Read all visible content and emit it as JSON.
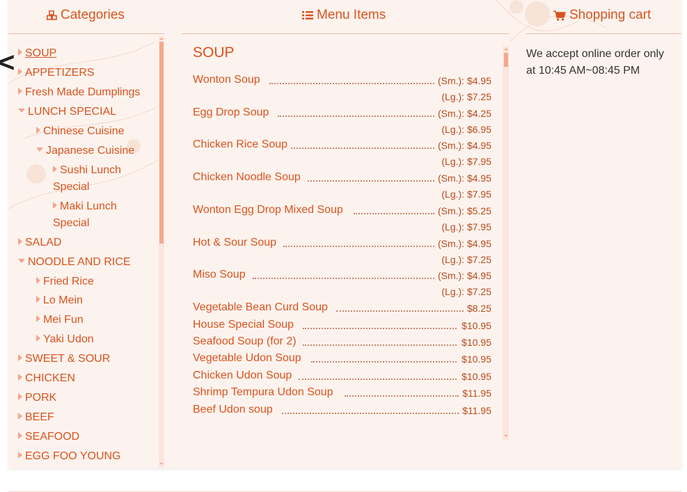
{
  "header": {
    "categories_label": "Categories",
    "menu_items_label": "Menu Items",
    "cart_label": "Shopping cart"
  },
  "sidebar": {
    "items": [
      {
        "label": "SOUP",
        "state": "active"
      },
      {
        "label": "APPETIZERS"
      },
      {
        "label": "Fresh Made Dumplings"
      },
      {
        "label": "LUNCH SPECIAL",
        "expanded": true
      },
      {
        "label": "Chinese Cuisine"
      },
      {
        "label": "Japanese Cuisine",
        "expanded": true
      },
      {
        "label": "Sushi Lunch Special"
      },
      {
        "label": "Maki Lunch Special"
      },
      {
        "label": "SALAD"
      },
      {
        "label": "NOODLE AND RICE",
        "expanded": true
      },
      {
        "label": "Fried Rice"
      },
      {
        "label": "Lo Mein"
      },
      {
        "label": "Mei Fun"
      },
      {
        "label": "Yaki Udon"
      },
      {
        "label": "SWEET & SOUR"
      },
      {
        "label": "CHICKEN"
      },
      {
        "label": "PORK"
      },
      {
        "label": "BEEF"
      },
      {
        "label": "SEAFOOD"
      },
      {
        "label": "EGG FOO YOUNG"
      }
    ]
  },
  "menu": {
    "title": "SOUP",
    "items": [
      {
        "name": "Wonton Soup",
        "price_sm": "(Sm.): $4.95",
        "price_lg": "(Lg.): $7.25"
      },
      {
        "name": "Egg Drop Soup",
        "price_sm": "(Sm.): $4.25",
        "price_lg": "(Lg.): $6.95"
      },
      {
        "name": "Chicken Rice Soup",
        "price_sm": "(Sm.): $4.95",
        "price_lg": "(Lg.): $7.95"
      },
      {
        "name": "Chicken Noodle Soup",
        "price_sm": "(Sm.): $4.95",
        "price_lg": "(Lg.): $7.95"
      },
      {
        "name": "Wonton Egg Drop Mixed Soup",
        "price_sm": "(Sm.): $5.25",
        "price_lg": "(Lg.): $7.95"
      },
      {
        "name": "Hot & Sour Soup",
        "price_sm": "(Sm.): $4.95",
        "price_lg": "(Lg.): $7.25"
      },
      {
        "name": "Miso Soup",
        "price_sm": "(Sm.): $4.95",
        "price_lg": "(Lg.): $7.25"
      },
      {
        "name": "Vegetable Bean Curd Soup",
        "price": "$8.25"
      },
      {
        "name": "House Special Soup",
        "price": "$10.95"
      },
      {
        "name": "Seafood Soup (for 2)",
        "price": "$10.95"
      },
      {
        "name": "Vegetable Udon Soup",
        "price": "$10.95"
      },
      {
        "name": "Chicken Udon Soup",
        "price": "$10.95"
      },
      {
        "name": "Shrimp Tempura Udon Soup",
        "price": "$11.95"
      },
      {
        "name": "Beef Udon soup",
        "price": "$11.95"
      }
    ]
  },
  "cart": {
    "notice": "We accept online order only at 10:45 AM~08:45 PM"
  },
  "icons": {
    "categories": "cubes-icon",
    "menu_items": "list-icon",
    "cart": "cart-icon"
  },
  "colors": {
    "accent": "#d9531e",
    "panel_bg": "#fdf3ee",
    "scroll_thumb": "#f4a98d"
  }
}
